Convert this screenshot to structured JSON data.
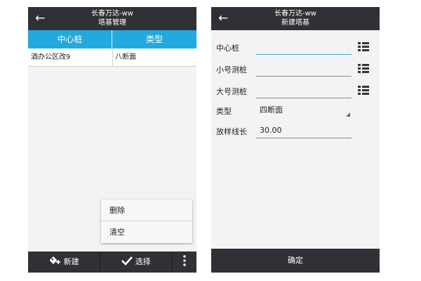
{
  "left_screen": {
    "app_title": "长春万达-ww",
    "screen_title": "塔基管理",
    "back_icon": "arrow-left-icon",
    "table": {
      "headers": [
        "中心桩",
        "类型"
      ],
      "rows": [
        [
          "酒办公区改9",
          "八断面"
        ]
      ]
    },
    "menu": {
      "items": [
        "删除",
        "清空"
      ]
    },
    "bottom_bar": {
      "new_label": "新建",
      "new_icon": "add-tower-icon",
      "select_label": "选择",
      "select_icon": "check-icon",
      "more_icon": "overflow-menu-icon"
    }
  },
  "right_screen": {
    "app_title": "长春万达-ww",
    "screen_title": "新建塔基",
    "back_icon": "arrow-left-icon",
    "fields": [
      {
        "label": "中心桩",
        "value": ""
      },
      {
        "label": "小号测桩",
        "value": ""
      },
      {
        "label": "大号测桩",
        "value": ""
      }
    ],
    "type_field": {
      "label": "类型",
      "value": "四断面"
    },
    "offset_field": {
      "label": "放样线长",
      "value": "30.00"
    },
    "list_icon": "list-icon",
    "confirm_label": "确定"
  },
  "colors": {
    "appbar": "#2f3136",
    "table_header": "#22a9dd",
    "screen_bg": "#f3f3f3"
  }
}
